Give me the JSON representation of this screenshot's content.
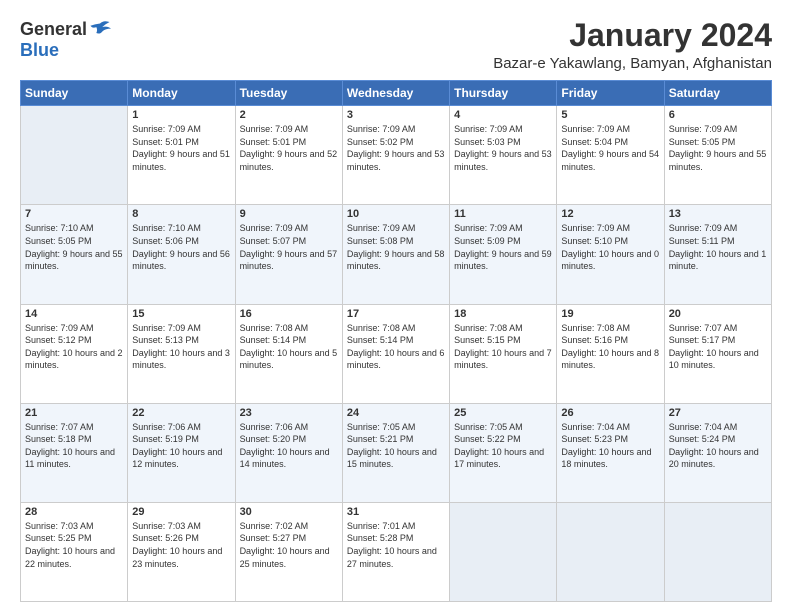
{
  "logo": {
    "general": "General",
    "blue": "Blue"
  },
  "header": {
    "title": "January 2024",
    "subtitle": "Bazar-e Yakawlang, Bamyan, Afghanistan"
  },
  "weekdays": [
    "Sunday",
    "Monday",
    "Tuesday",
    "Wednesday",
    "Thursday",
    "Friday",
    "Saturday"
  ],
  "weeks": [
    [
      {
        "day": "",
        "sunrise": "",
        "sunset": "",
        "daylight": ""
      },
      {
        "day": "1",
        "sunrise": "Sunrise: 7:09 AM",
        "sunset": "Sunset: 5:01 PM",
        "daylight": "Daylight: 9 hours and 51 minutes."
      },
      {
        "day": "2",
        "sunrise": "Sunrise: 7:09 AM",
        "sunset": "Sunset: 5:01 PM",
        "daylight": "Daylight: 9 hours and 52 minutes."
      },
      {
        "day": "3",
        "sunrise": "Sunrise: 7:09 AM",
        "sunset": "Sunset: 5:02 PM",
        "daylight": "Daylight: 9 hours and 53 minutes."
      },
      {
        "day": "4",
        "sunrise": "Sunrise: 7:09 AM",
        "sunset": "Sunset: 5:03 PM",
        "daylight": "Daylight: 9 hours and 53 minutes."
      },
      {
        "day": "5",
        "sunrise": "Sunrise: 7:09 AM",
        "sunset": "Sunset: 5:04 PM",
        "daylight": "Daylight: 9 hours and 54 minutes."
      },
      {
        "day": "6",
        "sunrise": "Sunrise: 7:09 AM",
        "sunset": "Sunset: 5:05 PM",
        "daylight": "Daylight: 9 hours and 55 minutes."
      }
    ],
    [
      {
        "day": "7",
        "sunrise": "Sunrise: 7:10 AM",
        "sunset": "Sunset: 5:05 PM",
        "daylight": "Daylight: 9 hours and 55 minutes."
      },
      {
        "day": "8",
        "sunrise": "Sunrise: 7:10 AM",
        "sunset": "Sunset: 5:06 PM",
        "daylight": "Daylight: 9 hours and 56 minutes."
      },
      {
        "day": "9",
        "sunrise": "Sunrise: 7:09 AM",
        "sunset": "Sunset: 5:07 PM",
        "daylight": "Daylight: 9 hours and 57 minutes."
      },
      {
        "day": "10",
        "sunrise": "Sunrise: 7:09 AM",
        "sunset": "Sunset: 5:08 PM",
        "daylight": "Daylight: 9 hours and 58 minutes."
      },
      {
        "day": "11",
        "sunrise": "Sunrise: 7:09 AM",
        "sunset": "Sunset: 5:09 PM",
        "daylight": "Daylight: 9 hours and 59 minutes."
      },
      {
        "day": "12",
        "sunrise": "Sunrise: 7:09 AM",
        "sunset": "Sunset: 5:10 PM",
        "daylight": "Daylight: 10 hours and 0 minutes."
      },
      {
        "day": "13",
        "sunrise": "Sunrise: 7:09 AM",
        "sunset": "Sunset: 5:11 PM",
        "daylight": "Daylight: 10 hours and 1 minute."
      }
    ],
    [
      {
        "day": "14",
        "sunrise": "Sunrise: 7:09 AM",
        "sunset": "Sunset: 5:12 PM",
        "daylight": "Daylight: 10 hours and 2 minutes."
      },
      {
        "day": "15",
        "sunrise": "Sunrise: 7:09 AM",
        "sunset": "Sunset: 5:13 PM",
        "daylight": "Daylight: 10 hours and 3 minutes."
      },
      {
        "day": "16",
        "sunrise": "Sunrise: 7:08 AM",
        "sunset": "Sunset: 5:14 PM",
        "daylight": "Daylight: 10 hours and 5 minutes."
      },
      {
        "day": "17",
        "sunrise": "Sunrise: 7:08 AM",
        "sunset": "Sunset: 5:14 PM",
        "daylight": "Daylight: 10 hours and 6 minutes."
      },
      {
        "day": "18",
        "sunrise": "Sunrise: 7:08 AM",
        "sunset": "Sunset: 5:15 PM",
        "daylight": "Daylight: 10 hours and 7 minutes."
      },
      {
        "day": "19",
        "sunrise": "Sunrise: 7:08 AM",
        "sunset": "Sunset: 5:16 PM",
        "daylight": "Daylight: 10 hours and 8 minutes."
      },
      {
        "day": "20",
        "sunrise": "Sunrise: 7:07 AM",
        "sunset": "Sunset: 5:17 PM",
        "daylight": "Daylight: 10 hours and 10 minutes."
      }
    ],
    [
      {
        "day": "21",
        "sunrise": "Sunrise: 7:07 AM",
        "sunset": "Sunset: 5:18 PM",
        "daylight": "Daylight: 10 hours and 11 minutes."
      },
      {
        "day": "22",
        "sunrise": "Sunrise: 7:06 AM",
        "sunset": "Sunset: 5:19 PM",
        "daylight": "Daylight: 10 hours and 12 minutes."
      },
      {
        "day": "23",
        "sunrise": "Sunrise: 7:06 AM",
        "sunset": "Sunset: 5:20 PM",
        "daylight": "Daylight: 10 hours and 14 minutes."
      },
      {
        "day": "24",
        "sunrise": "Sunrise: 7:05 AM",
        "sunset": "Sunset: 5:21 PM",
        "daylight": "Daylight: 10 hours and 15 minutes."
      },
      {
        "day": "25",
        "sunrise": "Sunrise: 7:05 AM",
        "sunset": "Sunset: 5:22 PM",
        "daylight": "Daylight: 10 hours and 17 minutes."
      },
      {
        "day": "26",
        "sunrise": "Sunrise: 7:04 AM",
        "sunset": "Sunset: 5:23 PM",
        "daylight": "Daylight: 10 hours and 18 minutes."
      },
      {
        "day": "27",
        "sunrise": "Sunrise: 7:04 AM",
        "sunset": "Sunset: 5:24 PM",
        "daylight": "Daylight: 10 hours and 20 minutes."
      }
    ],
    [
      {
        "day": "28",
        "sunrise": "Sunrise: 7:03 AM",
        "sunset": "Sunset: 5:25 PM",
        "daylight": "Daylight: 10 hours and 22 minutes."
      },
      {
        "day": "29",
        "sunrise": "Sunrise: 7:03 AM",
        "sunset": "Sunset: 5:26 PM",
        "daylight": "Daylight: 10 hours and 23 minutes."
      },
      {
        "day": "30",
        "sunrise": "Sunrise: 7:02 AM",
        "sunset": "Sunset: 5:27 PM",
        "daylight": "Daylight: 10 hours and 25 minutes."
      },
      {
        "day": "31",
        "sunrise": "Sunrise: 7:01 AM",
        "sunset": "Sunset: 5:28 PM",
        "daylight": "Daylight: 10 hours and 27 minutes."
      },
      {
        "day": "",
        "sunrise": "",
        "sunset": "",
        "daylight": ""
      },
      {
        "day": "",
        "sunrise": "",
        "sunset": "",
        "daylight": ""
      },
      {
        "day": "",
        "sunrise": "",
        "sunset": "",
        "daylight": ""
      }
    ]
  ]
}
